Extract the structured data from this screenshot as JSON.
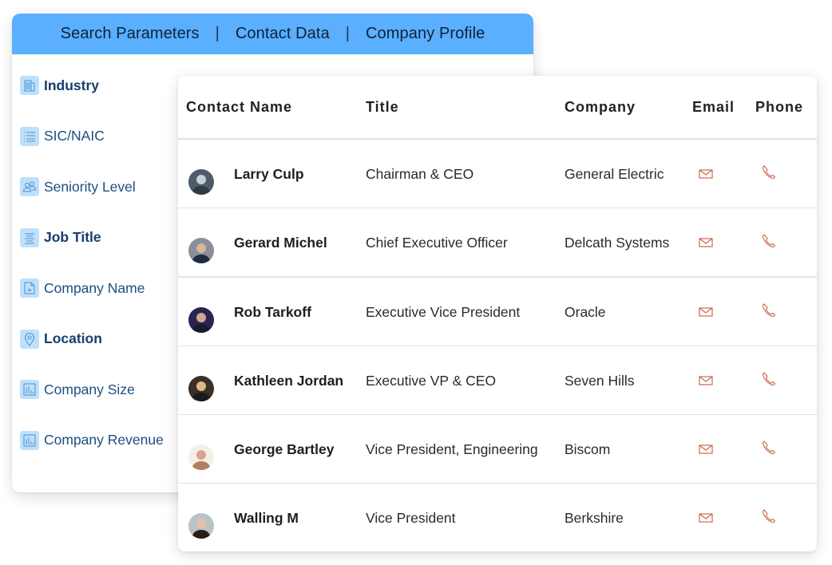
{
  "tabs": [
    {
      "label": "Search Parameters"
    },
    {
      "label": "Contact Data"
    },
    {
      "label": "Company Profile"
    }
  ],
  "tab_separator": "|",
  "search_parameters": [
    {
      "label": "Industry",
      "icon": "building-icon",
      "bold": true
    },
    {
      "label": "SIC/NAIC",
      "icon": "list-icon",
      "bold": false
    },
    {
      "label": "Seniority Level",
      "icon": "users-icon",
      "bold": false
    },
    {
      "label": "Job Title",
      "icon": "lines-icon",
      "bold": true
    },
    {
      "label": "Company Name",
      "icon": "document-plus-icon",
      "bold": false
    },
    {
      "label": "Location",
      "icon": "map-pin-icon",
      "bold": true
    },
    {
      "label": "Company Size",
      "icon": "bar-chart-icon",
      "bold": false
    },
    {
      "label": "Company Revenue",
      "icon": "bar-chart-icon",
      "bold": false
    }
  ],
  "table": {
    "columns": [
      "Contact Name",
      "Title",
      "Company",
      "Email",
      "Phone"
    ],
    "rows": [
      {
        "name": "Larry Culp",
        "title": "Chairman & CEO",
        "company": "General Electric"
      },
      {
        "name": "Gerard Michel",
        "title": "Chief Executive Officer",
        "company": "Delcath Systems"
      },
      {
        "name": "Rob Tarkoff",
        "title": "Executive Vice President",
        "company": "Oracle"
      },
      {
        "name": "Kathleen Jordan",
        "title": "Executive VP & CEO",
        "company": "Seven Hills"
      },
      {
        "name": "George Bartley",
        "title": "Vice President, Engineering",
        "company": "Biscom"
      },
      {
        "name": "Walling M",
        "title": "Vice President",
        "company": "Berkshire"
      }
    ]
  },
  "colors": {
    "tab_bar": "#5aafff",
    "param_text": "#1c4e80",
    "icon_bg": "#bfe0fb",
    "contact_icon": "#c8674f"
  }
}
